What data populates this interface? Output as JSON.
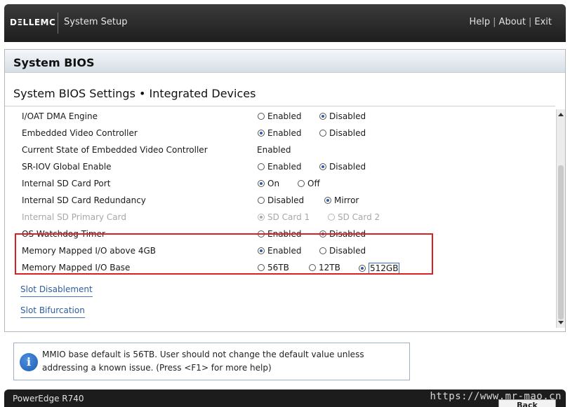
{
  "header": {
    "logo": "DΞLLEMC",
    "app_title": "System Setup",
    "links": [
      "Help",
      "About",
      "Exit"
    ],
    "separator": "|"
  },
  "page": {
    "title": "System BIOS",
    "subtitle": "System BIOS Settings • Integrated Devices"
  },
  "settings": [
    {
      "label": "I/OAT DMA Engine",
      "options": [
        {
          "label": "Enabled",
          "selected": false
        },
        {
          "label": "Disabled",
          "selected": true
        }
      ]
    },
    {
      "label": "Embedded Video Controller",
      "options": [
        {
          "label": "Enabled",
          "selected": true
        },
        {
          "label": "Disabled",
          "selected": false
        }
      ]
    },
    {
      "label": "Current State of Embedded Video Controller",
      "value": "Enabled"
    },
    {
      "label": "SR-IOV Global Enable",
      "options": [
        {
          "label": "Enabled",
          "selected": false
        },
        {
          "label": "Disabled",
          "selected": true
        }
      ]
    },
    {
      "label": "Internal SD Card Port",
      "options": [
        {
          "label": "On",
          "selected": true
        },
        {
          "label": "Off",
          "selected": false
        }
      ]
    },
    {
      "label": "Internal SD Card Redundancy",
      "options": [
        {
          "label": "Disabled",
          "selected": false
        },
        {
          "label": "Mirror",
          "selected": true
        }
      ]
    },
    {
      "label": "Internal SD Primary Card",
      "disabled": true,
      "options": [
        {
          "label": "SD Card 1",
          "selected": true
        },
        {
          "label": "SD Card 2",
          "selected": false
        }
      ]
    },
    {
      "label": "OS Watchdog Timer",
      "options": [
        {
          "label": "Enabled",
          "selected": false
        },
        {
          "label": "Disabled",
          "selected": true
        }
      ]
    },
    {
      "label": "Memory Mapped I/O above 4GB",
      "options": [
        {
          "label": "Enabled",
          "selected": true
        },
        {
          "label": "Disabled",
          "selected": false
        }
      ]
    },
    {
      "label": "Memory Mapped I/O Base",
      "options": [
        {
          "label": "56TB",
          "selected": false
        },
        {
          "label": "12TB",
          "selected": false
        },
        {
          "label": "512GB",
          "selected": true,
          "focused": true
        }
      ]
    }
  ],
  "links": [
    "Slot Disablement",
    "Slot Bifurcation"
  ],
  "help": {
    "icon": "info-icon",
    "text": "MMIO base default is 56TB. User should not change the default value unless addressing a known issue. (Press <F1> for more help)"
  },
  "footer": {
    "model": "PowerEdge R740",
    "watermark": "https://www.mr-mao.cn",
    "back_label": "Back"
  },
  "colors": {
    "highlight_box": "#d92121",
    "radio_selected": "#2f5aa8",
    "link": "#2d5e9f"
  }
}
